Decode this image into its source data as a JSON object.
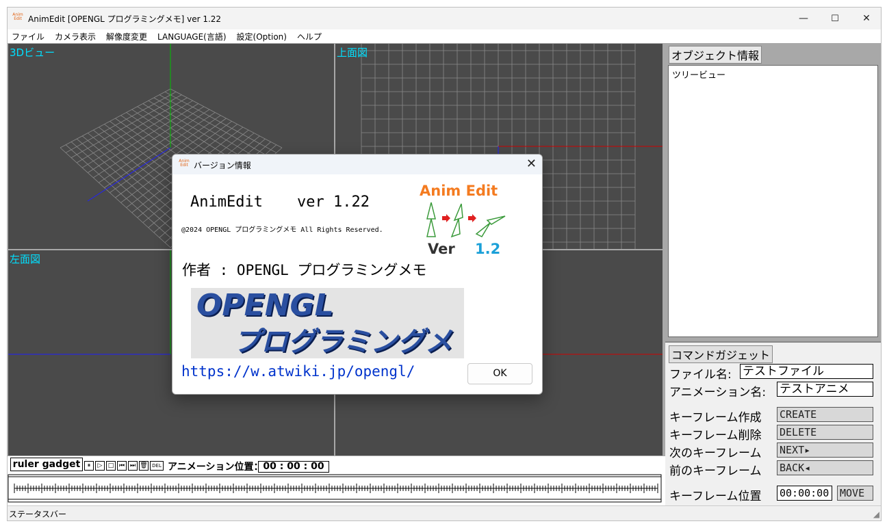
{
  "window": {
    "title": "AnimEdit [OPENGL プログラミングメモ] ver 1.22",
    "minimize": "—",
    "maximize": "☐",
    "close": "✕"
  },
  "menu": [
    "ファイル",
    "カメラ表示",
    "解像度変更",
    "LANGUAGE(言語)",
    "設定(Option)",
    "ヘルプ"
  ],
  "viewports": {
    "v3d": "3Dビュー",
    "top": "上面図",
    "left": "左面図"
  },
  "object_panel": {
    "title": "オブジェクト情報",
    "tree_label": "ツリービュー"
  },
  "command_panel": {
    "title": "コマンドガジェット",
    "file_name_label": "ファイル名:",
    "file_name_value": "テストファイル",
    "anim_name_label": "アニメーション名:",
    "anim_name_value": "テストアニメ",
    "kf_create_label": "キーフレーム作成",
    "kf_create_btn": "CREATE",
    "kf_delete_label": "キーフレーム削除",
    "kf_delete_btn": "DELETE",
    "kf_next_label": "次のキーフレーム",
    "kf_next_btn": "NEXT▸",
    "kf_prev_label": "前のキーフレーム",
    "kf_prev_btn": "BACK◂",
    "kf_pos_label": "キーフレーム位置",
    "kf_pos_value": "00:00:00",
    "kf_move_btn": "MOVE"
  },
  "ruler": {
    "tab": "ruler gadget",
    "buttons": [
      "⏸",
      "▷",
      "□",
      "⏮",
      "⏭",
      "🗑",
      "DEL"
    ],
    "pos_label": "アニメーション位置：",
    "pos_value": "00 : 00 : 00"
  },
  "statusbar": "ステータスバー",
  "dialog": {
    "title": "バージョン情報",
    "close": "✕",
    "app_name": "AnimEdit",
    "version": "ver 1.22",
    "copyright": "@2024 OPENGL プログラミングメモ All Rights Reserved.",
    "author": "作者 : OPENGL プログラミングメモ",
    "banner_line1": "OPENGL",
    "banner_line2": "プログラミングメモ",
    "url": "https://w.atwiki.jp/opengl/",
    "ok": "OK",
    "logo_title": "Anim Edit",
    "logo_ver": "Ver",
    "logo_num": "1.2"
  },
  "colors": {
    "viewport_bg": "#4a4a4a",
    "viewport_label": "#00e0ff",
    "url": "#0033cc",
    "logo_orange": "#f47b20",
    "logo_blue": "#1ba0d8"
  }
}
